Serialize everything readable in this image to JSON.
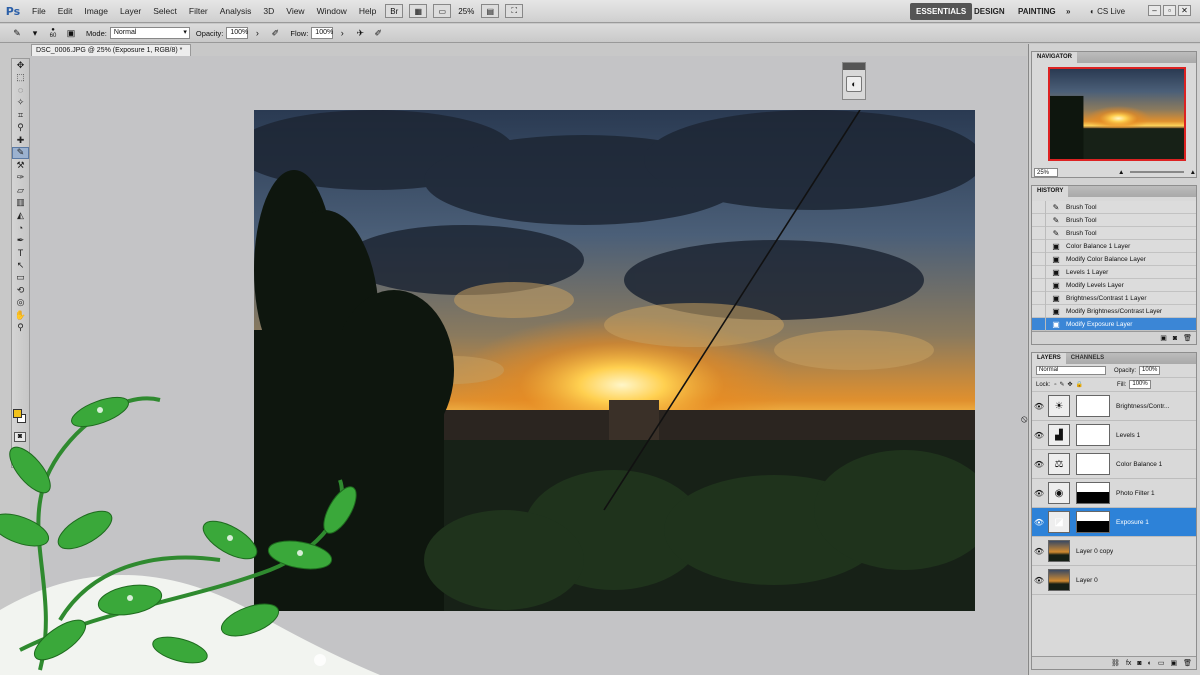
{
  "menubar": {
    "logo": "Ps",
    "items": [
      "File",
      "Edit",
      "Image",
      "Layer",
      "Select",
      "Filter",
      "Analysis",
      "3D",
      "View",
      "Window",
      "Help"
    ],
    "zoom": "25%",
    "workspaces": [
      "ESSENTIALS",
      "DESIGN",
      "PAINTING"
    ],
    "more": "»",
    "cslive": "CS Live"
  },
  "options": {
    "mode_label": "Mode:",
    "mode_value": "Normal",
    "opacity_label": "Opacity:",
    "opacity_value": "100%",
    "flow_label": "Flow:",
    "flow_value": "100%",
    "brush_size": "60"
  },
  "document": {
    "tab_title": "DSC_0006.JPG @ 25% (Exposure 1, RGB/8) *"
  },
  "navigator": {
    "tab": "NAVIGATOR",
    "zoom": "25%"
  },
  "history": {
    "tab": "HISTORY",
    "items": [
      "Brush Tool",
      "Brush Tool",
      "Brush Tool",
      "Color Balance 1 Layer",
      "Modify Color Balance Layer",
      "Levels 1 Layer",
      "Modify Levels Layer",
      "Brightness/Contrast 1 Layer",
      "Modify Brightness/Contrast Layer",
      "Modify Exposure Layer"
    ]
  },
  "layers": {
    "tabs": [
      "LAYERS",
      "CHANNELS"
    ],
    "blend_mode": "Normal",
    "opacity_label": "Opacity:",
    "opacity_value": "100%",
    "lock_label": "Lock:",
    "fill_label": "Fill:",
    "fill_value": "100%",
    "items": [
      {
        "name": "Brightness/Contr...",
        "icon": "brightness-icon"
      },
      {
        "name": "Levels 1",
        "icon": "levels-icon"
      },
      {
        "name": "Color Balance 1",
        "icon": "balance-icon"
      },
      {
        "name": "Photo Filter 1",
        "icon": "photo-filter-icon"
      },
      {
        "name": "Exposure 1",
        "icon": "exposure-icon"
      },
      {
        "name": "Layer 0 copy",
        "icon": "image-thumb"
      },
      {
        "name": "Layer 0",
        "icon": "image-thumb"
      }
    ]
  },
  "colors": {
    "accent": "#2d82d8",
    "foreground": "#f2c21a",
    "background": "#ffffff"
  }
}
